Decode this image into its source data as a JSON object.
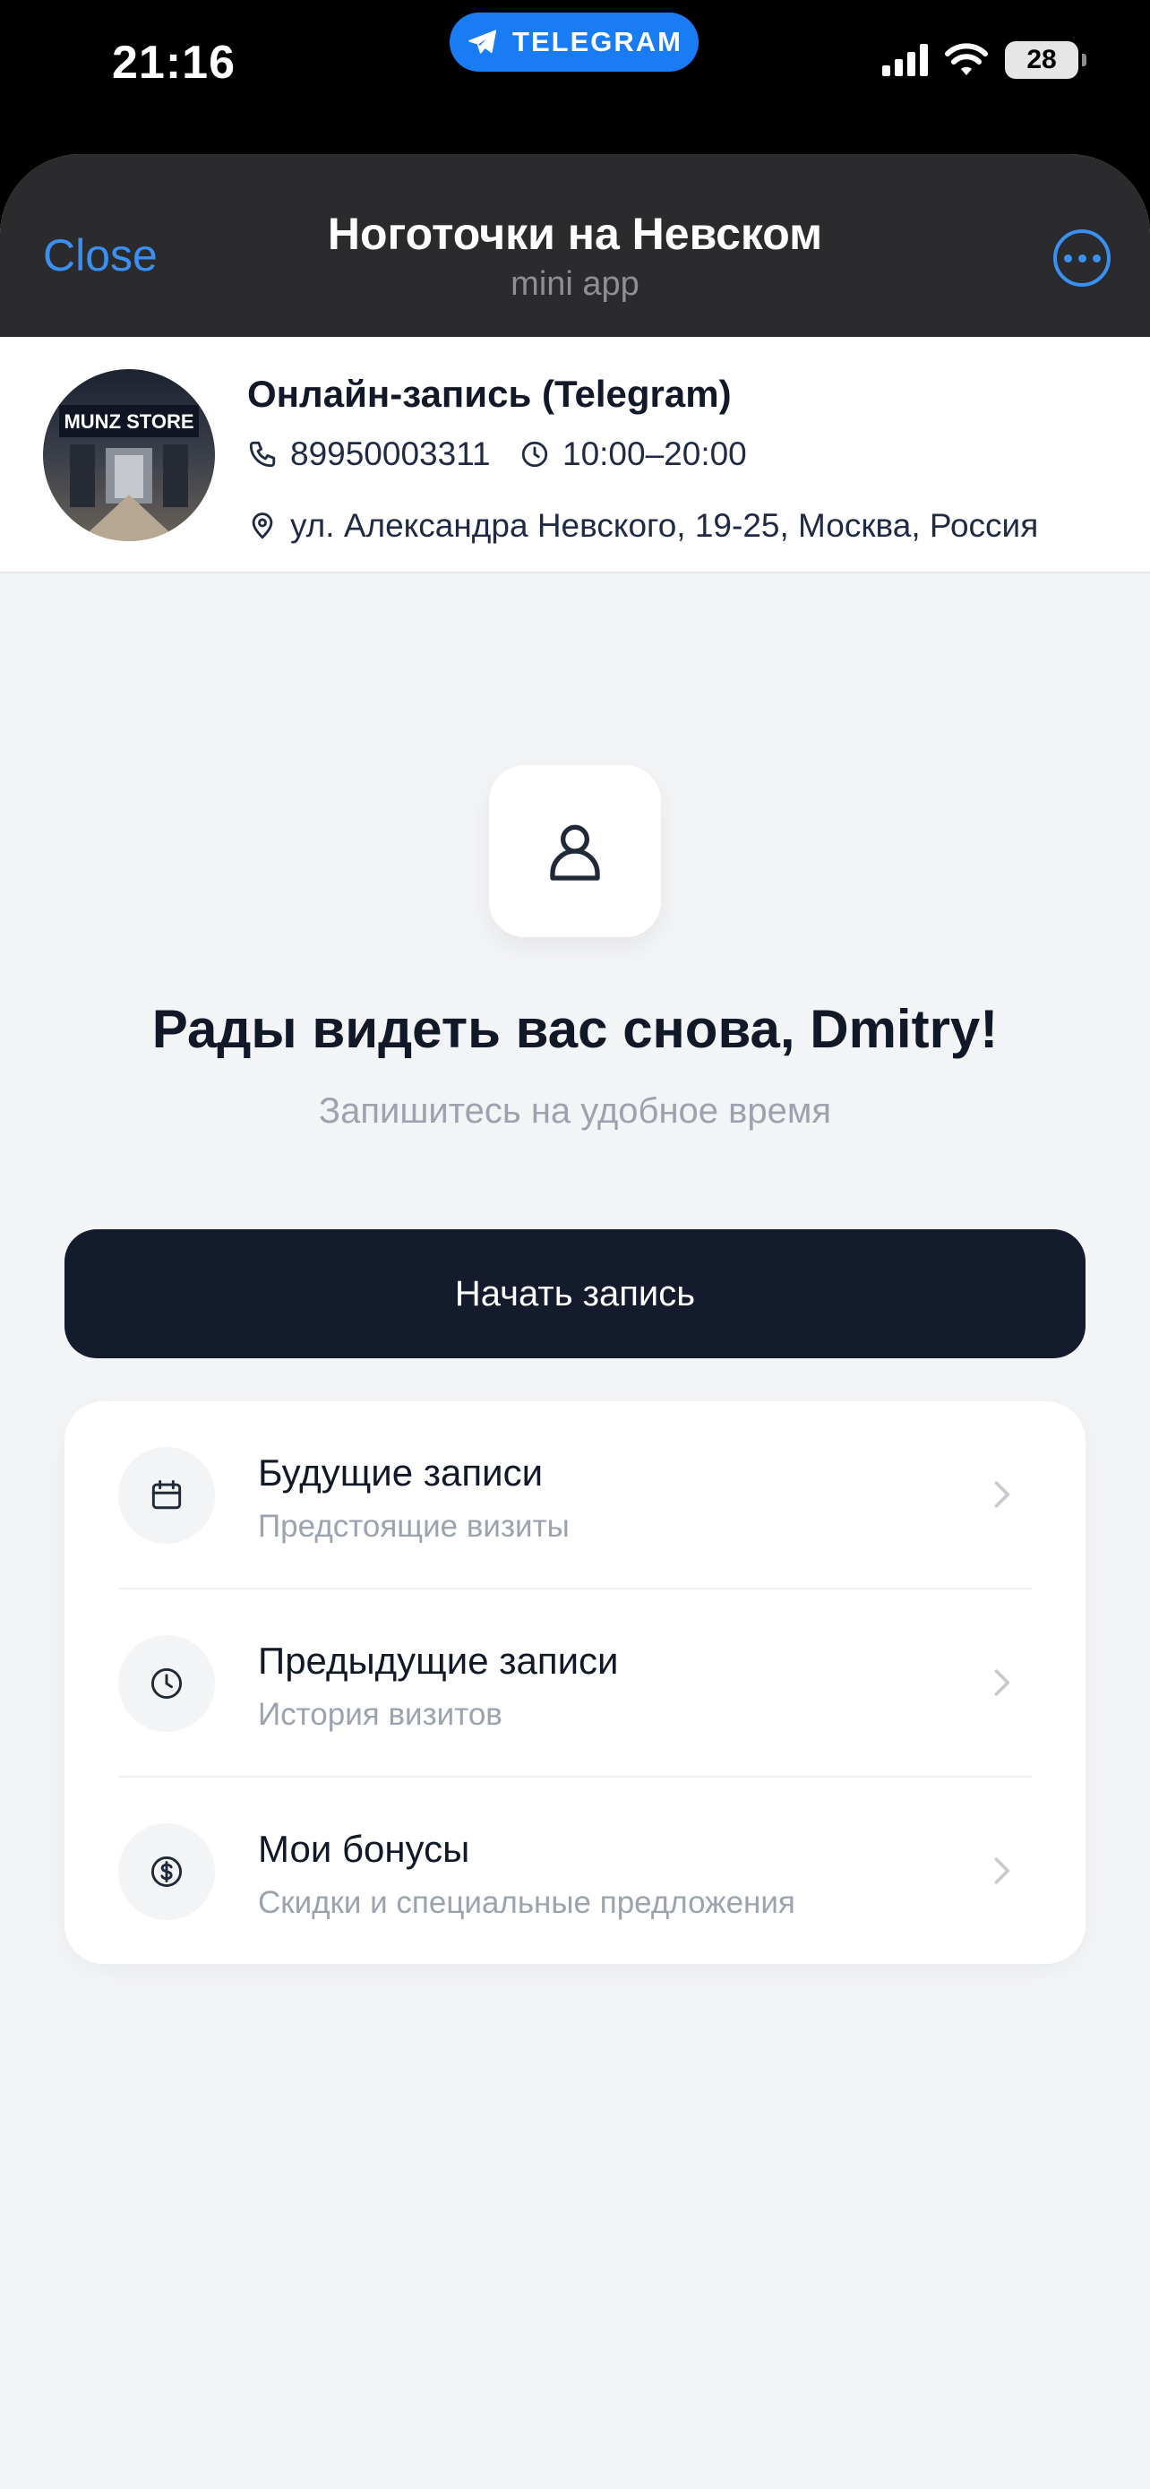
{
  "status_bar": {
    "time": "21:16",
    "telegram_label": "TELEGRAM",
    "battery": "28"
  },
  "nav": {
    "close_label": "Close",
    "title": "Ноготочки на Невском",
    "subtitle": "mini app",
    "accent_color": "#3b8ff1"
  },
  "business": {
    "name": "Онлайн-запись (Telegram)",
    "phone": "89950003311",
    "hours": "10:00–20:00",
    "address": "ул. Александра Невского, 19-25, Москва, Россия",
    "avatar_text": "MUNZ STORE"
  },
  "welcome": {
    "title": "Рады видеть вас снова, Dmitry!",
    "subtitle": "Запишитесь на удобное время"
  },
  "cta": {
    "label": "Начать запись"
  },
  "menu": [
    {
      "label": "Будущие записи",
      "description": "Предстоящие визиты",
      "icon": "calendar-icon"
    },
    {
      "label": "Предыдущие записи",
      "description": "История визитов",
      "icon": "clock-icon"
    },
    {
      "label": "Мои бонусы",
      "description": "Скидки и специальные предложения",
      "icon": "dollar-icon"
    }
  ]
}
